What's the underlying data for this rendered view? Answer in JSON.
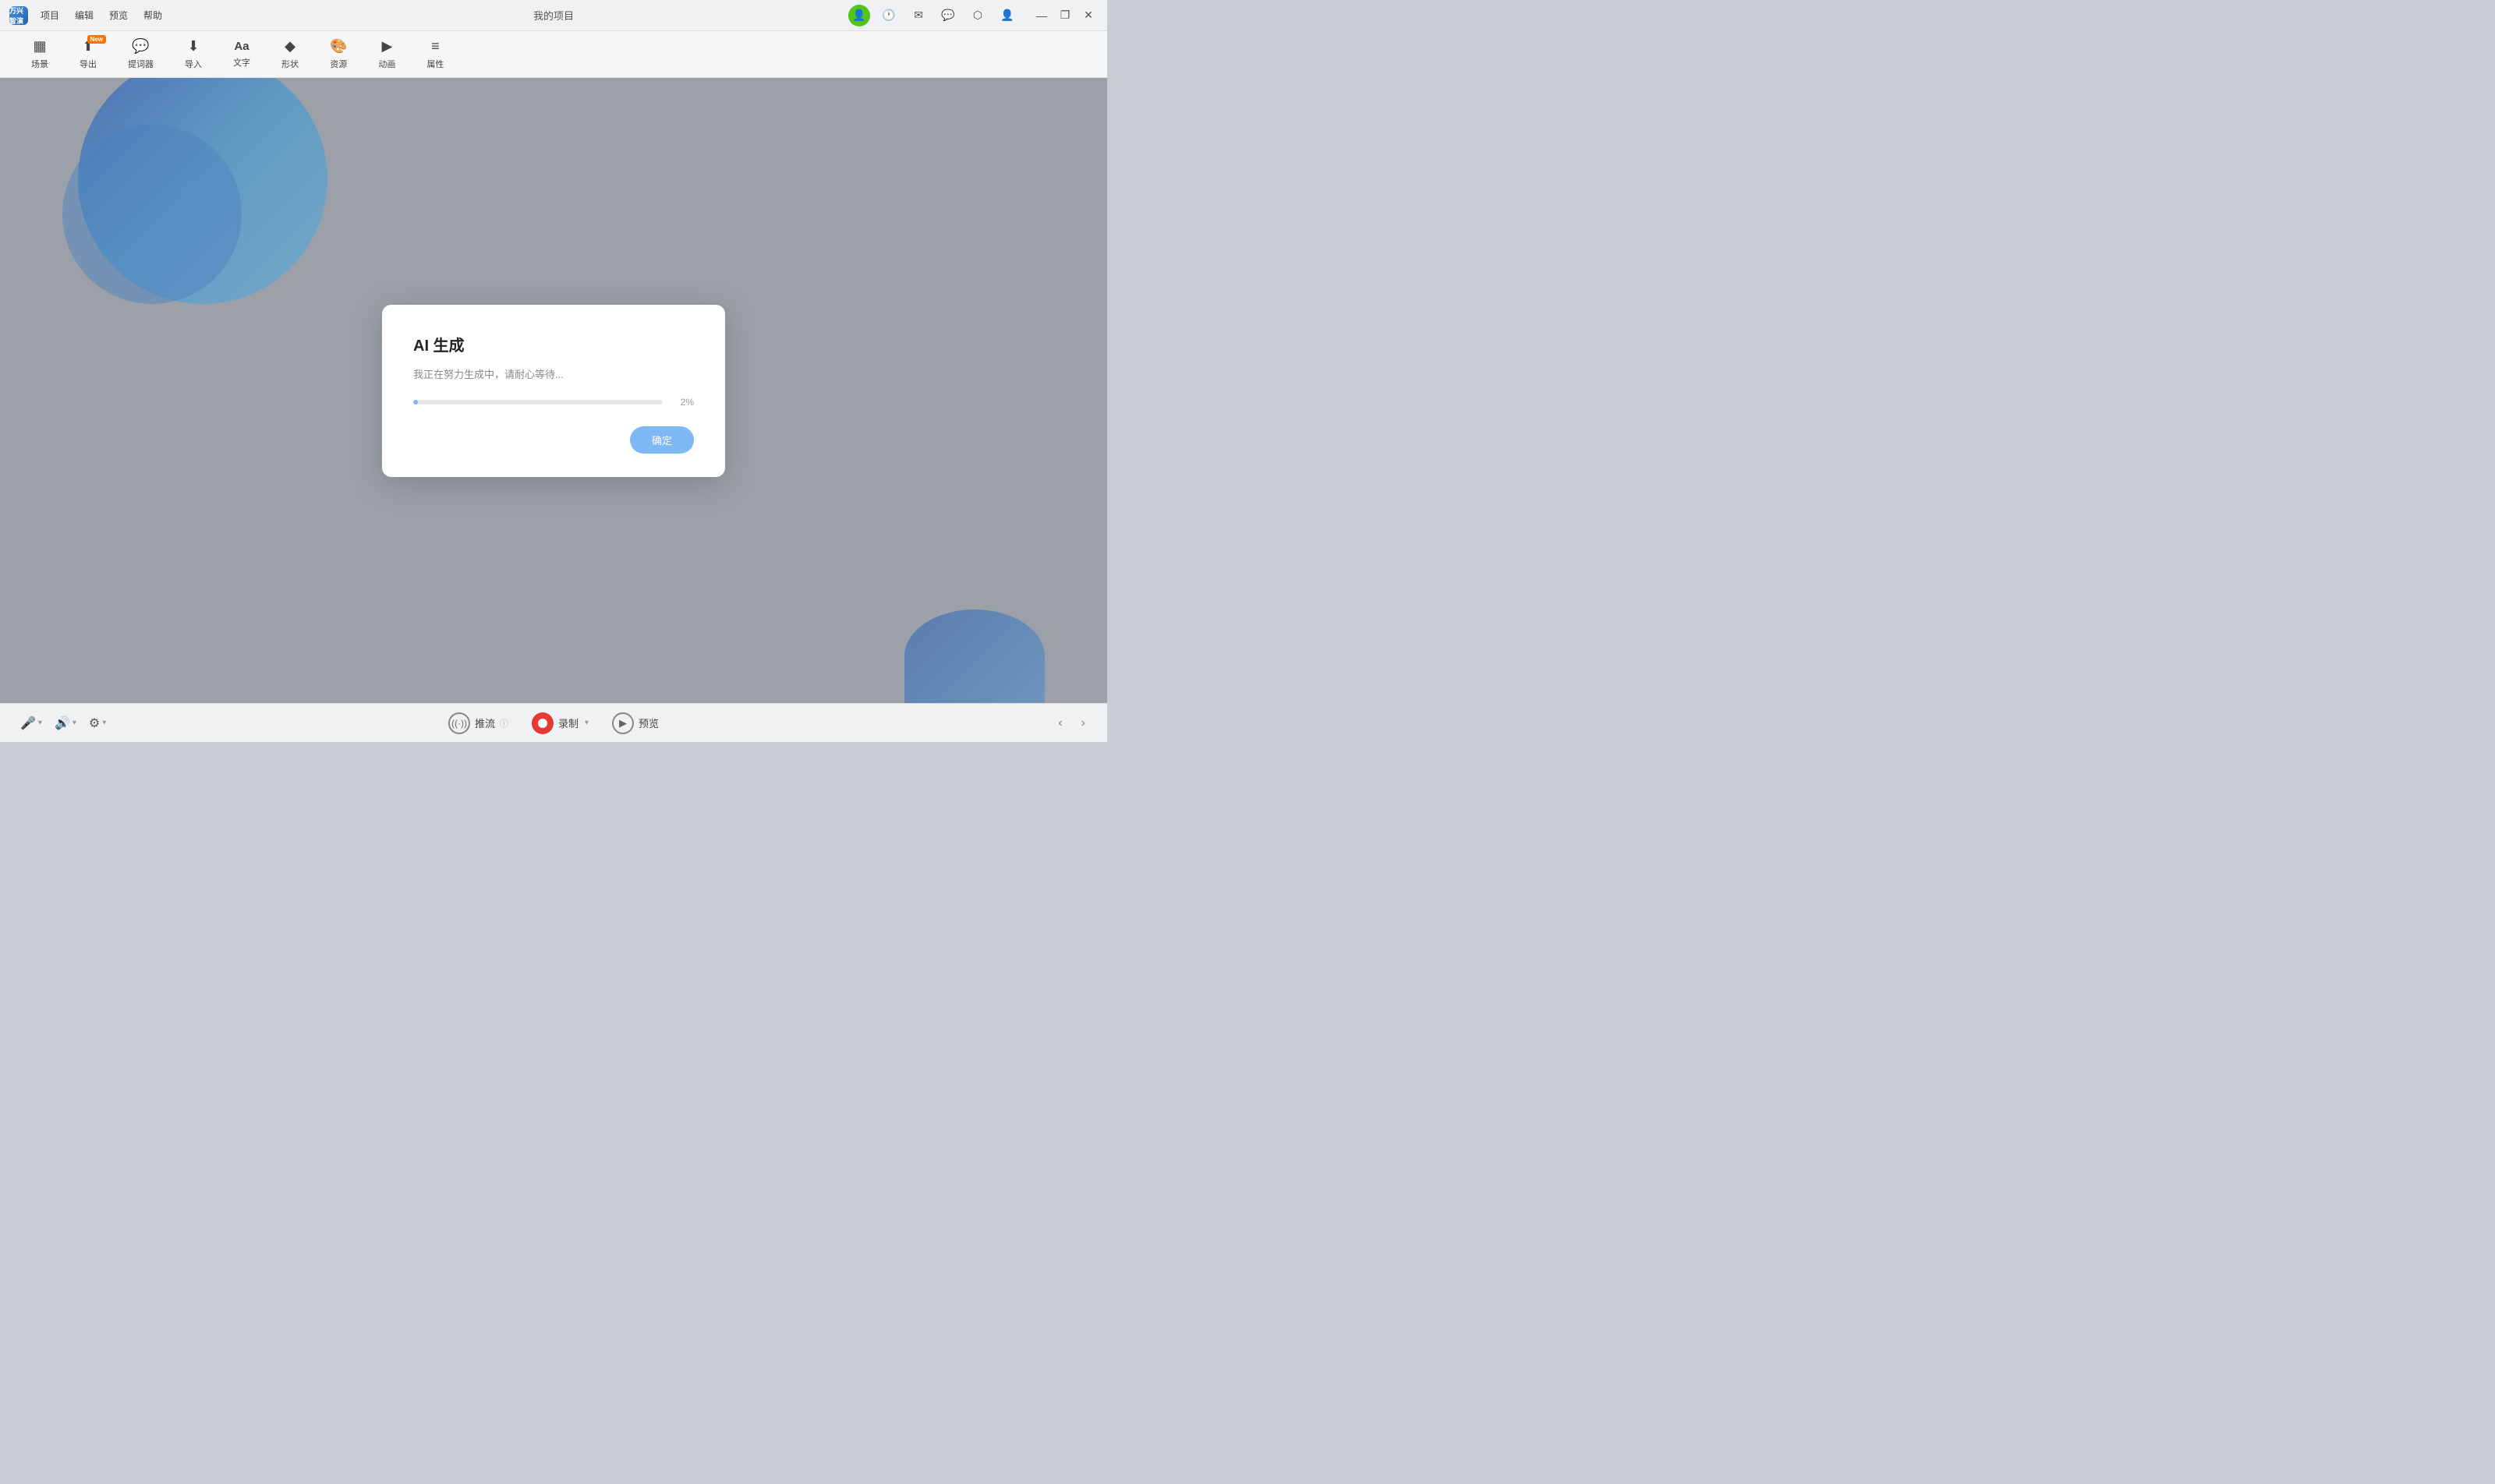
{
  "app": {
    "title": "万兴智演",
    "project_title": "我的项目"
  },
  "title_bar": {
    "logo_text": "万",
    "menu_items": [
      "项目",
      "编辑",
      "预览",
      "帮助"
    ],
    "center_text": "我的项目",
    "window_controls": [
      "—",
      "❐",
      "✕"
    ]
  },
  "toolbar": {
    "items": [
      {
        "id": "scene",
        "label": "场景",
        "icon": "▦",
        "badge": null
      },
      {
        "id": "export",
        "label": "导出",
        "icon": "⬆",
        "badge": "New"
      },
      {
        "id": "prompter",
        "label": "提词器",
        "icon": "💬",
        "badge": null
      },
      {
        "id": "import",
        "label": "导入",
        "icon": "⬇",
        "badge": null
      },
      {
        "id": "text",
        "label": "文字",
        "icon": "Aa",
        "badge": null
      },
      {
        "id": "shape",
        "label": "形状",
        "icon": "◆",
        "badge": null
      },
      {
        "id": "resource",
        "label": "资源",
        "icon": "🎨",
        "badge": null
      },
      {
        "id": "animation",
        "label": "动画",
        "icon": "▶",
        "badge": null
      },
      {
        "id": "properties",
        "label": "属性",
        "icon": "≡",
        "badge": null
      }
    ]
  },
  "dialog": {
    "title": "AI 生成",
    "message": "我正在努力生成中，请耐心等待...",
    "progress_percent": 2,
    "progress_display": "2%",
    "confirm_label": "确定"
  },
  "bottom_bar": {
    "stream_label": "推流",
    "record_label": "录制",
    "preview_label": "预览"
  }
}
